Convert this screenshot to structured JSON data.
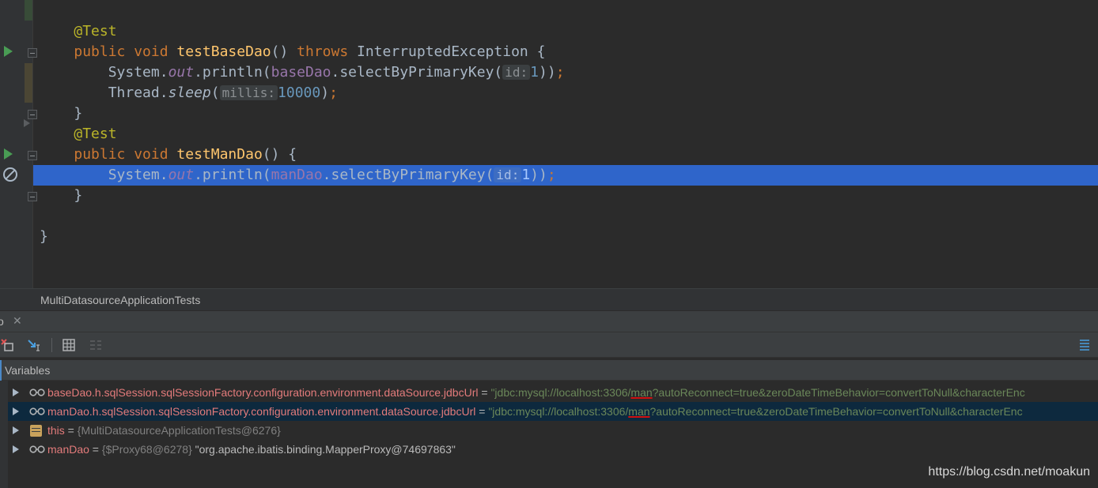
{
  "editor": {
    "lines": [
      {
        "parts": [
          [
            "ann",
            "@Test"
          ]
        ]
      },
      {
        "parts": [
          [
            "kw",
            "public void "
          ],
          [
            "fn",
            "testBaseDao"
          ],
          [
            "plain",
            "() "
          ],
          [
            "kw",
            "throws "
          ],
          [
            "plain",
            "InterruptedException {"
          ]
        ]
      },
      {
        "parts": [
          [
            "plain",
            "    System."
          ],
          [
            "field it",
            "out"
          ],
          [
            "plain",
            ".println("
          ],
          [
            "field",
            "baseDao"
          ],
          [
            "plain",
            ".selectByPrimaryKey("
          ],
          [
            "hint",
            "id:"
          ],
          [
            "num",
            "1"
          ],
          [
            "plain",
            "))"
          ],
          [
            "kw",
            ";"
          ]
        ]
      },
      {
        "parts": [
          [
            "plain",
            "    Thread."
          ],
          [
            "it",
            "sleep"
          ],
          [
            "plain",
            "("
          ],
          [
            "hint",
            "millis:"
          ],
          [
            "num",
            "10000"
          ],
          [
            "plain",
            ")"
          ],
          [
            "kw",
            ";"
          ]
        ]
      },
      {
        "parts": [
          [
            "plain",
            "}"
          ]
        ]
      },
      {
        "parts": [
          [
            "ann",
            "@Test"
          ]
        ]
      },
      {
        "parts": [
          [
            "kw",
            "public void "
          ],
          [
            "fn",
            "testManDao"
          ],
          [
            "plain",
            "() {"
          ]
        ]
      },
      {
        "parts": [
          [
            "plain",
            "    System."
          ],
          [
            "field it",
            "out"
          ],
          [
            "plain",
            ".println("
          ],
          [
            "field",
            "manDao"
          ],
          [
            "plain",
            ".selectByPrimaryKey("
          ],
          [
            "hint",
            "id:"
          ],
          [
            "num",
            "1"
          ],
          [
            "plain",
            "))"
          ],
          [
            "kw",
            ";"
          ]
        ],
        "highlight": true
      },
      {
        "parts": [
          [
            "plain",
            "}"
          ]
        ]
      },
      {
        "parts": [
          [
            "plain",
            ""
          ]
        ]
      },
      {
        "parts": [
          [
            "plain",
            "}"
          ]
        ],
        "outdent": true
      }
    ]
  },
  "breadcrumb": {
    "label": "MultiDatasourceApplicationTests"
  },
  "debug": {
    "tab_label": "o",
    "tab_close": "✕",
    "variables_title": "Variables",
    "rows": [
      {
        "name": "baseDao.h.sqlSession.sqlSessionFactory.configuration.environment.dataSource.jdbcUrl",
        "eq": " = ",
        "pre": "\"jdbc:mysql://localhost:3306/",
        "mark": "man",
        "post": "?autoReconnect=true&zeroDateTimeBehavior=convertToNull&characterEnc",
        "icon": "watch"
      },
      {
        "name": "manDao.h.sqlSession.sqlSessionFactory.configuration.environment.dataSource.jdbcUrl",
        "eq": " = ",
        "pre": "\"jdbc:mysql://localhost:3306/",
        "mark": "man",
        "post": "?autoReconnect=true&zeroDateTimeBehavior=convertToNull&characterEnc",
        "icon": "watch",
        "selected": true
      },
      {
        "name": "this",
        "eq": " = ",
        "type": "{MultiDatasourceApplicationTests@6276}",
        "icon": "object"
      },
      {
        "name": "manDao",
        "eq": " = ",
        "type": "{$Proxy68@6278}",
        "value": " \"org.apache.ibatis.binding.MapperProxy@74697863\"",
        "icon": "watch"
      }
    ]
  },
  "watermark": "https://blog.csdn.net/moakun",
  "colors": {
    "highlight": "#2f65ca",
    "keyword": "#cc7832",
    "annotation": "#bbb529",
    "function": "#ffc66d",
    "field": "#9876aa",
    "number": "#6897bb",
    "var_name": "#e37b7b",
    "string": "#6a8759"
  }
}
